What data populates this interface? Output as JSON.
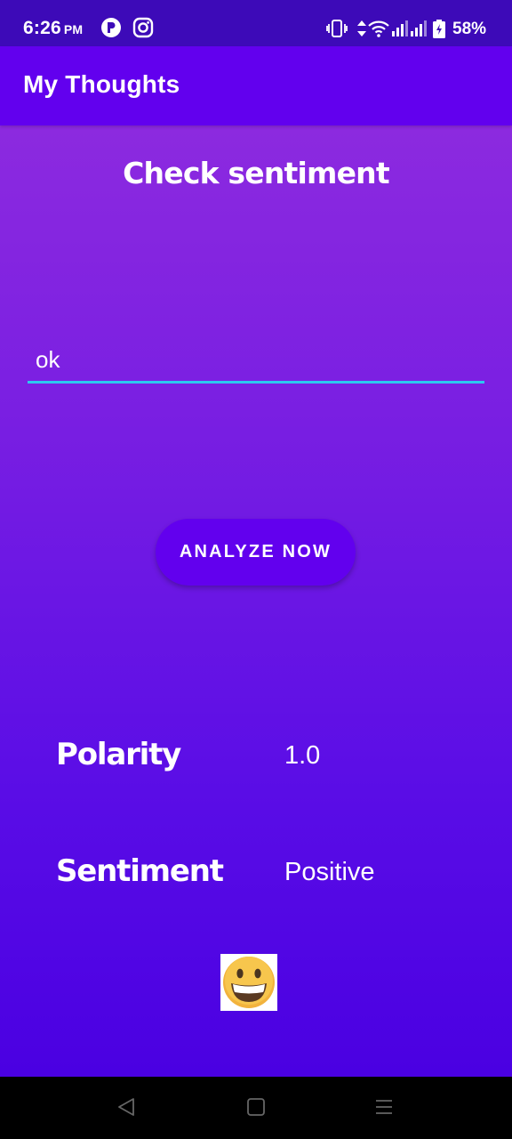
{
  "status_bar": {
    "time": "6:26",
    "ampm": "PM",
    "battery_percent": "58%",
    "icons": [
      "notification-p-icon",
      "instagram-icon",
      "vibrate-icon",
      "data-arrows-icon",
      "wifi-icon",
      "signal-icon",
      "signal-icon",
      "battery-charging-icon"
    ]
  },
  "app_bar": {
    "title": "My Thoughts"
  },
  "main": {
    "heading": "Check sentiment",
    "input_value": "ok",
    "analyze_button_label": "ANALYZE NOW",
    "polarity_label": "Polarity",
    "polarity_value": "1.0",
    "sentiment_label": "Sentiment",
    "sentiment_value": "Positive",
    "emoji_icon": "smiling-face-icon"
  },
  "nav_bar": {
    "icons": [
      "back-icon",
      "home-icon",
      "menu-icon"
    ]
  },
  "colors": {
    "status_bar": "#3d0ab8",
    "app_bar": "#6200ee",
    "gradient_top": "#8c2adf",
    "gradient_bottom": "#4a00e2",
    "input_underline": "#2ec7f0",
    "button": "#6200ee",
    "nav_bar": "#000000"
  }
}
